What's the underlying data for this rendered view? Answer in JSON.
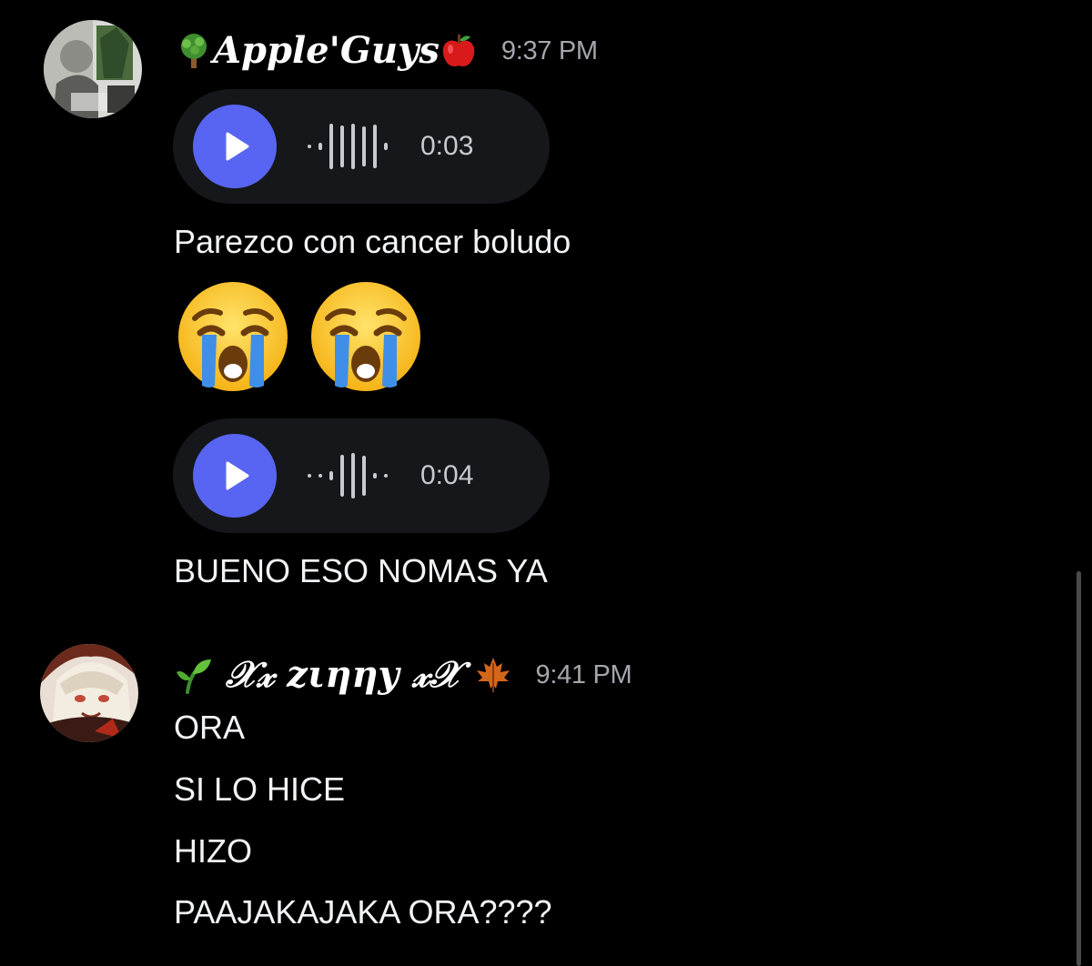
{
  "messages": [
    {
      "author": "Apple'Guys",
      "author_prefix_icon": "tree-emoji",
      "author_suffix_icon": "red-apple-emoji",
      "time": "9:37 PM",
      "avatar_icon": "anime-character-avatar",
      "content": [
        {
          "type": "voice",
          "duration": "0:03"
        },
        {
          "type": "text",
          "text": "Parezco con cancer boludo"
        },
        {
          "type": "emoji",
          "icons": [
            "loudly-crying-face-emoji",
            "loudly-crying-face-emoji"
          ]
        },
        {
          "type": "voice",
          "duration": "0:04"
        },
        {
          "type": "text",
          "text": "BUENO ESO NOMAS YA"
        }
      ]
    },
    {
      "author": "𝒳𝓍 zιηηу 𝓍𝒳",
      "author_prefix_icon": "seedling-emoji",
      "author_suffix_icon": "maple-leaf-emoji",
      "time": "9:41 PM",
      "avatar_icon": "anime-character-avatar",
      "content": [
        {
          "type": "text",
          "text": "ORA"
        },
        {
          "type": "text",
          "text": "SI LO HICE"
        },
        {
          "type": "text",
          "text": "HIZO"
        },
        {
          "type": "text",
          "text": "PAAJAKAJAKA ORA????"
        }
      ]
    }
  ],
  "colors": {
    "background": "#000000",
    "voice_pill": "#16171a",
    "play_button": "#5865f2",
    "timestamp": "#a3a6ad",
    "text": "#f2f3f5"
  }
}
